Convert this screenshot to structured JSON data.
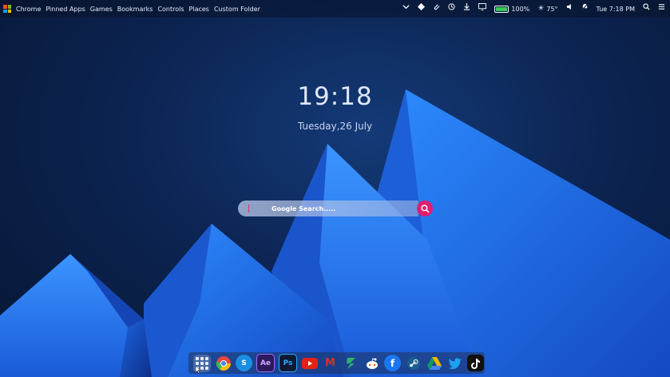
{
  "top_menu": {
    "items": [
      "Chrome",
      "Pinned Apps",
      "Games",
      "Bookmarks",
      "Controls",
      "Places",
      "Custom Folder"
    ]
  },
  "tray": {
    "icons": [
      "chevron-down-icon",
      "diamond-icon",
      "paperclip-icon",
      "history-icon",
      "download-icon",
      "monitor-icon",
      "battery-icon",
      "sun-icon",
      "volume-icon",
      "notification-off-icon",
      "search-icon",
      "menu-icon"
    ],
    "battery_percent_label": "100%",
    "battery_level": 1.0,
    "weather": "75°",
    "datetime": "Tue 7:18 PM"
  },
  "clock": {
    "time": "19:18",
    "date": "Tuesday,26 July"
  },
  "search": {
    "placeholder": "Google Search.....",
    "button_icon": "search-icon"
  },
  "dock": {
    "apps": [
      {
        "name": "app-launcher",
        "icon": "apps-grid-icon"
      },
      {
        "name": "chrome",
        "icon": "chrome-icon",
        "color": "#e8453c"
      },
      {
        "name": "skype",
        "icon": "skype-icon",
        "label": "S",
        "color": "#1a8ee1"
      },
      {
        "name": "after-effects",
        "icon": "after-effects-icon",
        "label": "Ae",
        "color": "#2b1a5c"
      },
      {
        "name": "photoshop",
        "icon": "photoshop-icon",
        "label": "Ps",
        "color": "#0c1b33"
      },
      {
        "name": "youtube",
        "icon": "youtube-icon",
        "color": "#e62117"
      },
      {
        "name": "gmail",
        "icon": "gmail-icon",
        "label": "M",
        "color": "#d93025"
      },
      {
        "name": "zeplin",
        "icon": "zeplin-icon",
        "color": "#2fb36f"
      },
      {
        "name": "reddit",
        "icon": "reddit-icon",
        "color": "#ffffff"
      },
      {
        "name": "facebook",
        "icon": "facebook-icon",
        "label": "f",
        "color": "#1877f2"
      },
      {
        "name": "steam",
        "icon": "steam-icon",
        "color": "#1b5e8f"
      },
      {
        "name": "google-drive",
        "icon": "google-drive-icon",
        "color": "#f4b400"
      },
      {
        "name": "twitter",
        "icon": "twitter-icon",
        "color": "#1da1f2"
      },
      {
        "name": "tiktok",
        "icon": "tiktok-icon",
        "color": "#111111"
      }
    ]
  },
  "colors": {
    "accent": "#e01e6e",
    "wallpaper_dark": "#071633",
    "wallpaper_blue": "#1e72e6"
  }
}
